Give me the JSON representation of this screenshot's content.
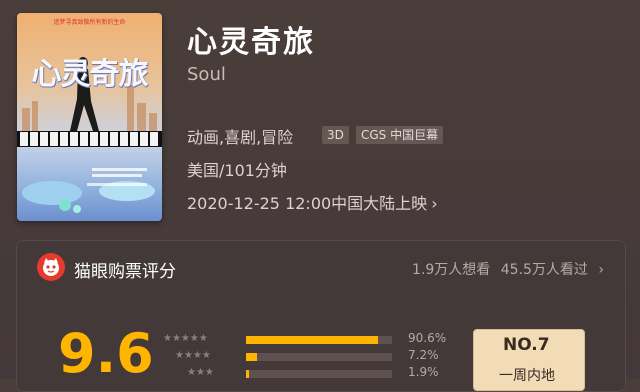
{
  "movie": {
    "poster_title": "心灵奇旅",
    "poster_top_text": "追梦寻真致敬所有新的生命",
    "title": "心灵奇旅",
    "original_title": "Soul",
    "genres": "动画,喜剧,冒险",
    "tags": [
      "3D",
      "CGS 中国巨幕"
    ],
    "region_runtime": "美国/101分钟",
    "release": "2020-12-25 12:00中国大陆上映",
    "release_chevron": "›"
  },
  "rating": {
    "card_title": "猫眼购票评分",
    "want_watch": "1.9万人想看",
    "watched": "45.5万人看过",
    "chevron": "›",
    "score": "9.6",
    "distribution": [
      {
        "stars": "★★★★★",
        "percent_label": "90.6%",
        "percent": 90.6
      },
      {
        "stars": "★★★★",
        "percent_label": "7.2%",
        "percent": 7.2
      },
      {
        "stars": "★★★",
        "percent_label": "1.9%",
        "percent": 1.9
      }
    ],
    "rank_no": "NO.7",
    "rank_label": "一周内地"
  },
  "colors": {
    "accent": "#ffb400",
    "maoyan_red": "#e63a2f",
    "background": "#4a3e3a"
  }
}
